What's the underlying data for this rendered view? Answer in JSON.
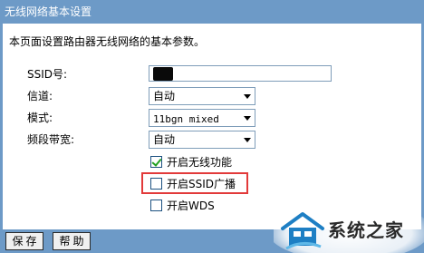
{
  "header": {
    "title": "无线网络基本设置"
  },
  "description": "本页面设置路由器无线网络的基本参数。",
  "fields": {
    "ssid_label": "SSID号:",
    "channel_label": "信道:",
    "channel_value": "自动",
    "mode_label": "模式:",
    "mode_value": "11bgn mixed",
    "bandwidth_label": "频段带宽:",
    "bandwidth_value": "自动"
  },
  "checkboxes": [
    {
      "label": "开启无线功能",
      "checked": true
    },
    {
      "label": "开启SSID广播",
      "checked": false
    },
    {
      "label": "开启WDS",
      "checked": false
    }
  ],
  "buttons": {
    "save": "保存",
    "help": "帮助"
  },
  "watermark": {
    "text": "系统之家",
    "icon": "house-logo-icon"
  },
  "colors": {
    "frame": "#6d9ac7",
    "highlight": "#e23a3a",
    "check": "#21a121"
  }
}
